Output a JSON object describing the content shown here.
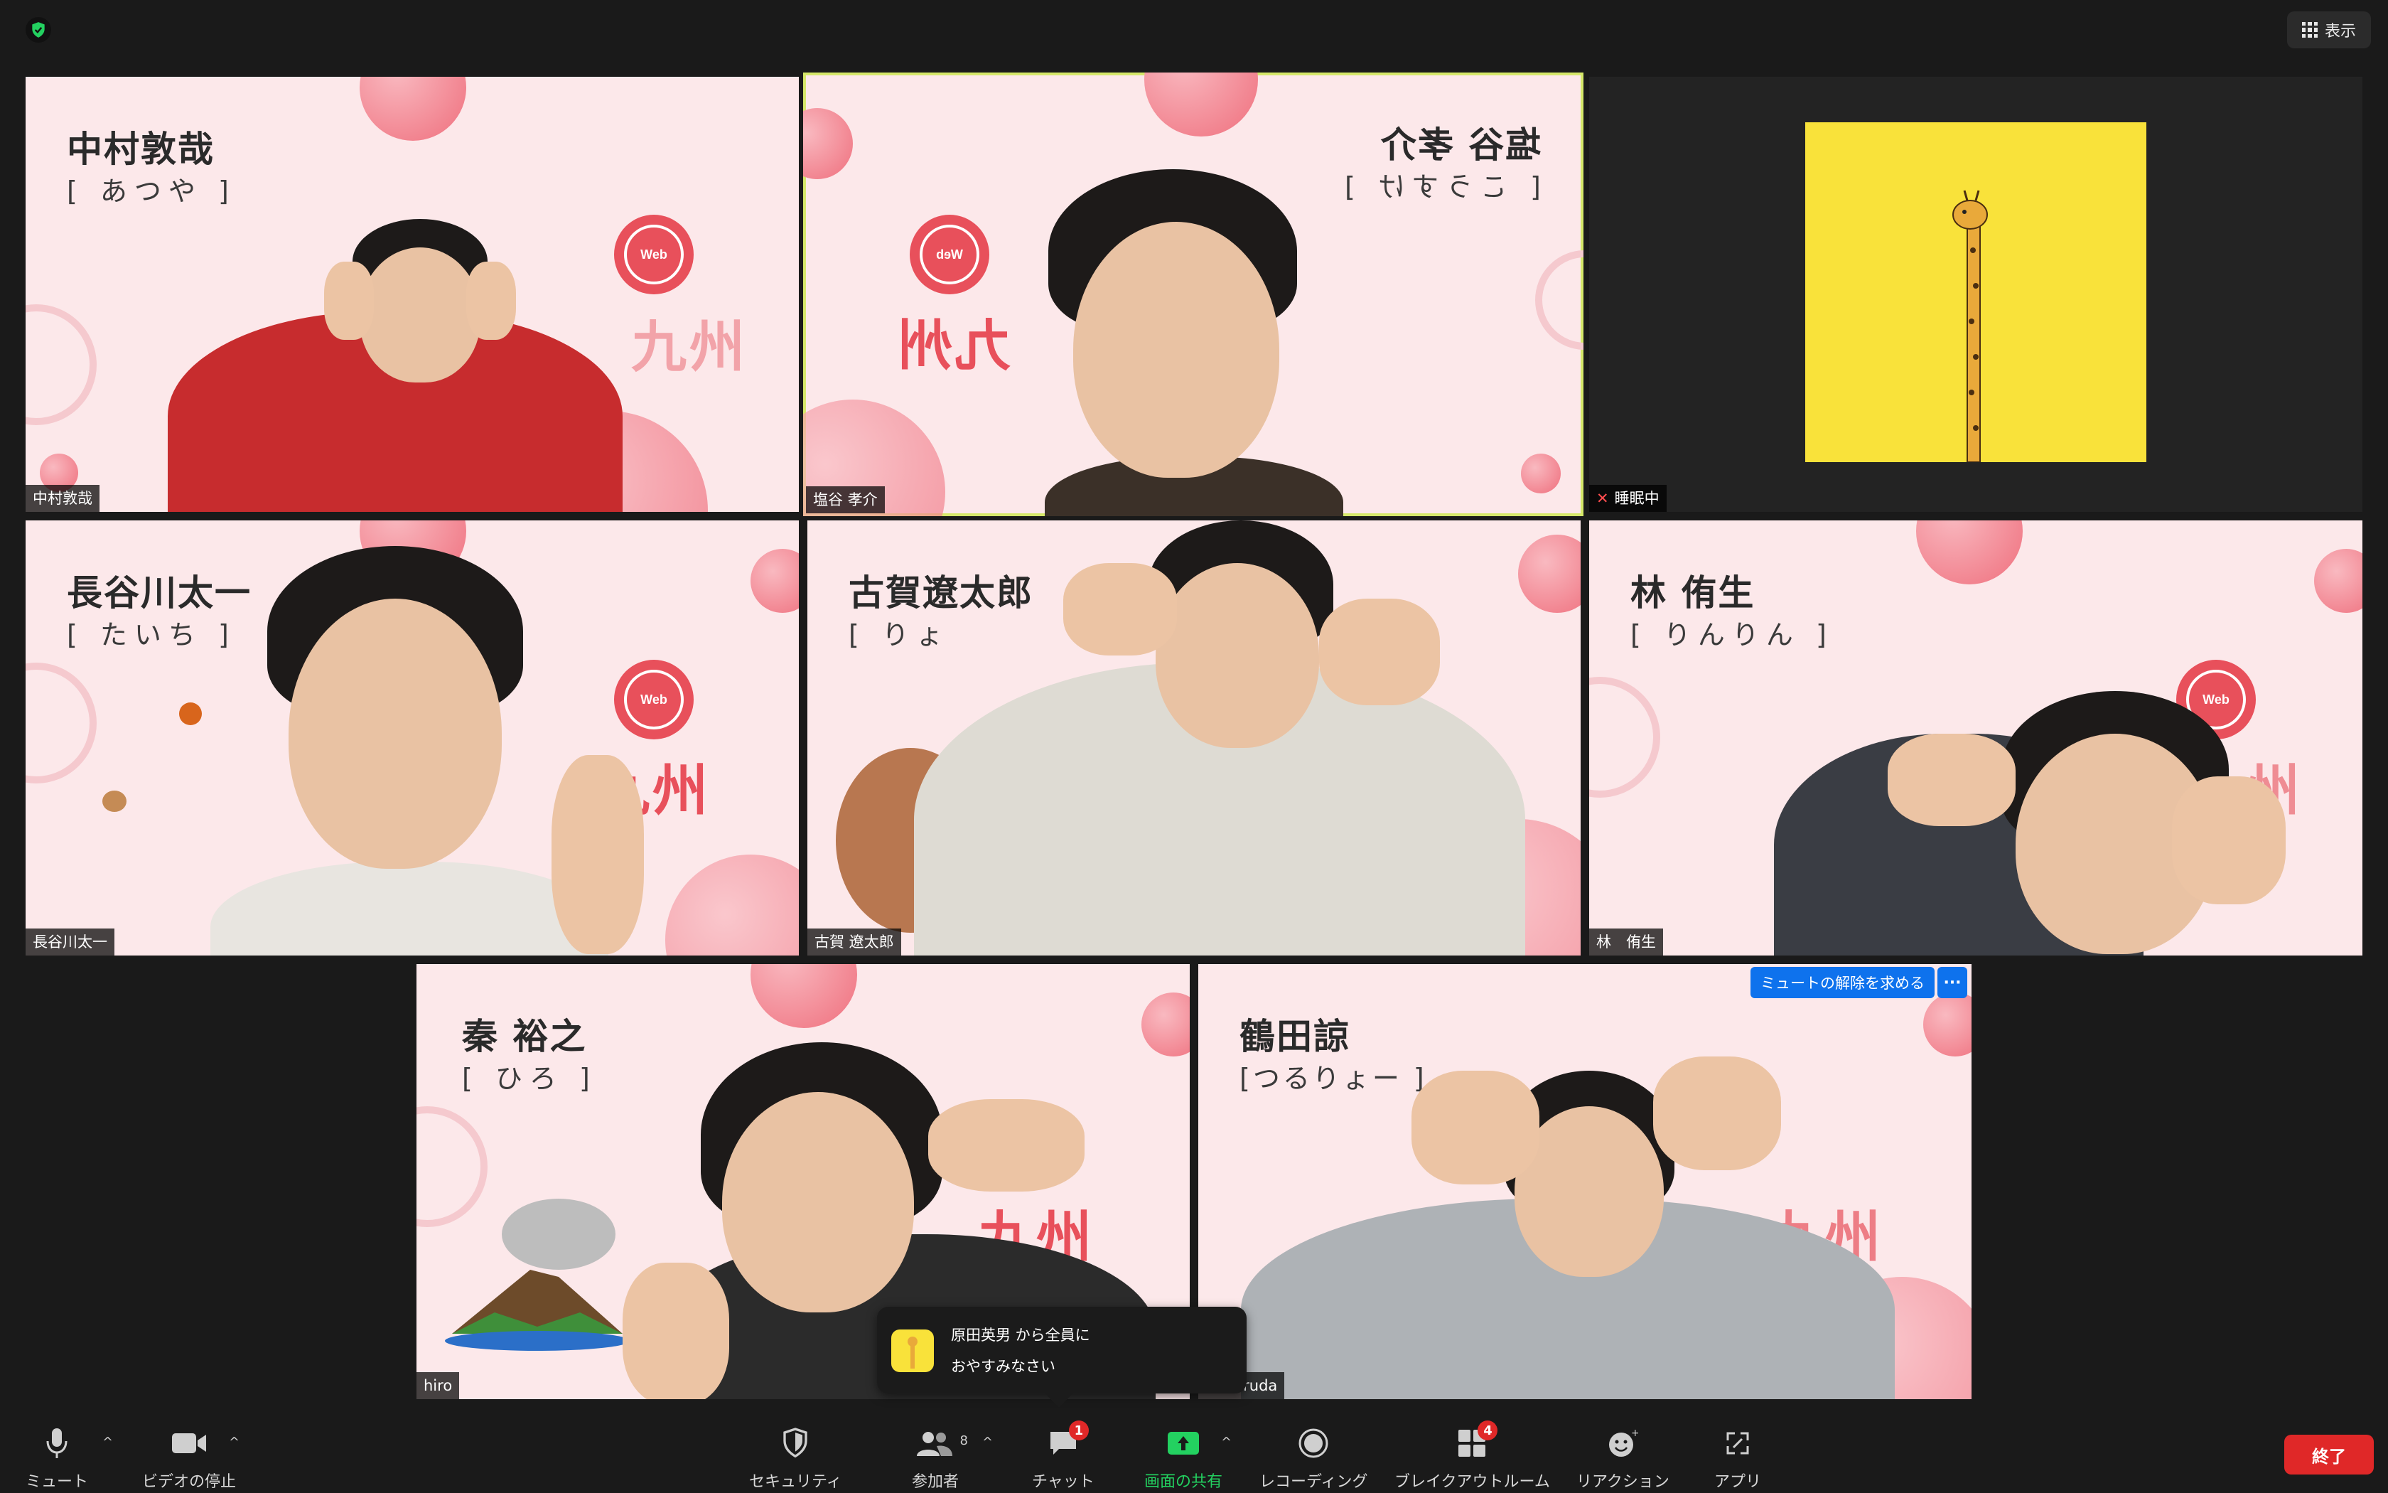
{
  "top": {
    "view_label": "表示"
  },
  "tiles": [
    {
      "id": "t1",
      "label": "中村敦哉",
      "bg_name": "中村敦哉",
      "bg_kana": "[ あつや ]"
    },
    {
      "id": "t2",
      "label": "塩谷 孝介",
      "bg_name": "塩谷 孝介",
      "bg_kana": "[ こうすけ ]"
    },
    {
      "id": "t3",
      "label": "睡眠中"
    },
    {
      "id": "t4",
      "label": "長谷川太一",
      "bg_name": "長谷川太一",
      "bg_kana": "[ たいち ]"
    },
    {
      "id": "t5",
      "label": "古賀 遼太郎",
      "bg_name": "古賀遼太郎",
      "bg_kana": "[ りょ"
    },
    {
      "id": "t6",
      "label": "林　侑生",
      "bg_name": "林 侑生",
      "bg_kana": "[ りんりん ]"
    },
    {
      "id": "t7",
      "label": "hiro",
      "bg_name": "秦 裕之",
      "bg_kana": "[ ひろ ]"
    },
    {
      "id": "t8",
      "label": "o Tsuruda",
      "bg_name": "鶴田諒",
      "bg_kana": "[つるりょー ]"
    }
  ],
  "brand": {
    "kyushu": "九州",
    "logo_text": "Web"
  },
  "unmute_request": "ミュートの解除を求める",
  "more_label": "···",
  "chat_popup": {
    "from": "原田英男 から全員に",
    "message": "おやすみなさい"
  },
  "toolbar": {
    "mute": "ミュート",
    "stop_video": "ビデオの停止",
    "security": "セキュリティ",
    "participants": "参加者",
    "participants_count": "8",
    "chat": "チャット",
    "chat_badge": "1",
    "share": "画面の共有",
    "record": "レコーディング",
    "breakout": "ブレイクアウトルーム",
    "breakout_badge": "4",
    "reactions": "リアクション",
    "apps": "アプリ",
    "end": "終了"
  },
  "colors": {
    "accent_green": "#23d160",
    "end_red": "#e02828",
    "unmute_blue": "#0e72ed",
    "active_border": "#d6e86a",
    "brand_red": "#e8505b"
  }
}
